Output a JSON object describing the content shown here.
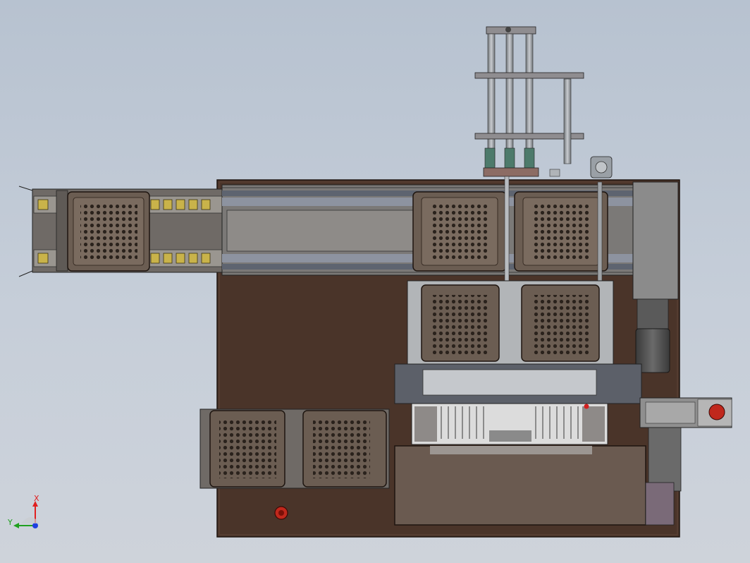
{
  "colors": {
    "background_top": "#b7c2d0",
    "background_bottom": "#ced3da",
    "base_plate": "#4a3429",
    "tray": "#6b5d52",
    "tray_hole": "#2a221c",
    "steel": "#8c8c8c",
    "rail": "#5e6470",
    "axis_x": "#e02020",
    "axis_y": "#20a020",
    "axis_z": "#2040e0",
    "stop_button": "#c0281c"
  },
  "triad": {
    "x_label": "X",
    "y_label": "Y"
  },
  "icons": {
    "emergency_stop": "emergency-stop-icon",
    "coordinate_triad": "coordinate-triad-icon"
  }
}
